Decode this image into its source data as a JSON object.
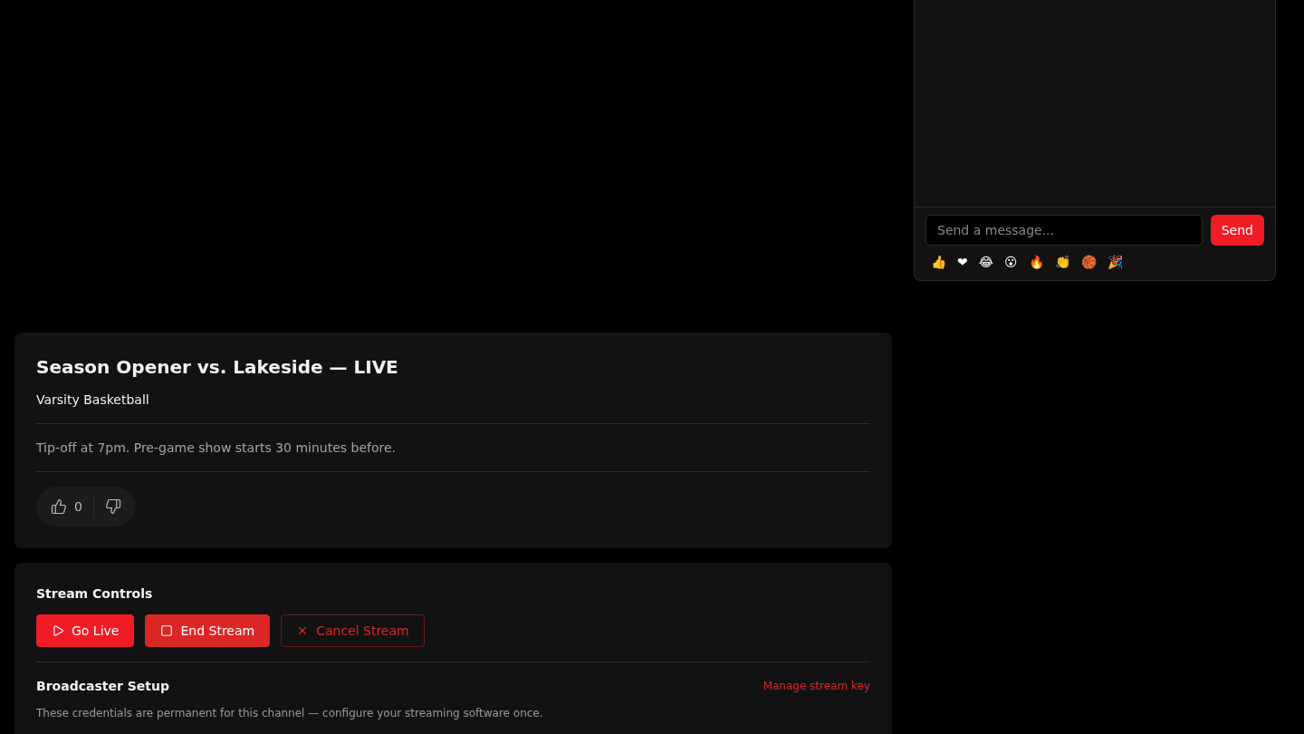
{
  "chat": {
    "placeholder": "Send a message...",
    "send": "Send",
    "emojis": [
      "👍",
      "❤",
      "😂",
      "😮",
      "🔥",
      "👏",
      "🏀",
      "🎉"
    ]
  },
  "event": {
    "title": "Season Opener vs. Lakeside — LIVE",
    "category": "Varsity Basketball",
    "description": "Tip-off at 7pm. Pre-game show starts 30 minutes before.",
    "likes": "0"
  },
  "stream_controls": {
    "title": "Stream Controls",
    "buttons": [
      {
        "label": "Go Live",
        "kind": "primary"
      },
      {
        "label": "End Stream",
        "kind": "danger"
      },
      {
        "label": "Cancel Stream",
        "kind": "outline"
      }
    ]
  },
  "broadcaster_setup": {
    "title": "Broadcaster Setup",
    "link": "Manage stream key",
    "description": "These credentials are permanent for this channel — configure your streaming software once."
  }
}
